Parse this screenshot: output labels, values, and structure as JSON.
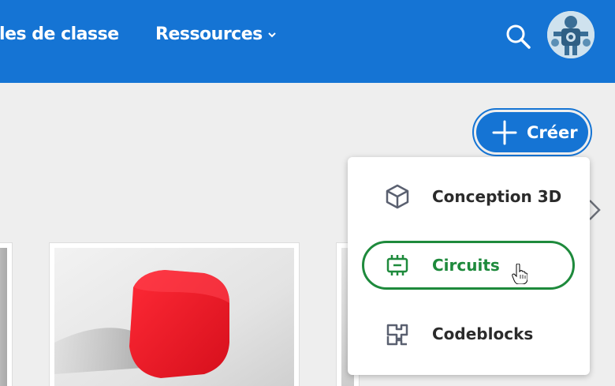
{
  "nav": {
    "classes_label": "lles de classe",
    "resources_label": "Ressources",
    "resources_icon": "chevron-down-icon",
    "search_icon": "search-icon",
    "avatar_icon": "robot-avatar"
  },
  "create_button": {
    "label": "Créer",
    "icon": "plus-icon"
  },
  "create_menu": {
    "items": [
      {
        "label": "Conception 3D",
        "icon": "cube-icon"
      },
      {
        "label": "Circuits",
        "icon": "chip-icon",
        "state": "hovered"
      },
      {
        "label": "Codeblocks",
        "icon": "codeblocks-icon"
      }
    ]
  },
  "colors": {
    "header": "#1574d4",
    "accent": "#1574d4",
    "circuits_green": "#1e8a3c",
    "background": "#eeeeee"
  }
}
